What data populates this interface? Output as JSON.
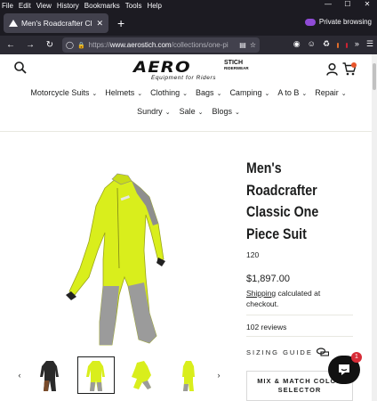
{
  "menubar": {
    "items": [
      "File",
      "Edit",
      "View",
      "History",
      "Bookmarks",
      "Tools",
      "Help"
    ]
  },
  "window_controls": {
    "minimize": "—",
    "maximize": "☐",
    "close": "✕"
  },
  "tab": {
    "title": "Men's Roadcrafter Classic One",
    "close": "✕"
  },
  "newtab": "+",
  "private_label": "Private browsing",
  "address": {
    "url_prefix": "https://",
    "url_main": "www.aerostich.com",
    "url_rest": "/collections/one-pi"
  },
  "toolbar_badges": {
    "ext1": "",
    "ext2": ""
  },
  "logo": {
    "main": "AERO",
    "stich": "STICH",
    "sub": "RIDERWEAR",
    "tagline": "Equipment for Riders"
  },
  "nav": {
    "row1": [
      "Motorcycle Suits",
      "Helmets",
      "Clothing",
      "Bags",
      "Camping",
      "A to B",
      "Repair"
    ],
    "row2": [
      "Sundry",
      "Sale",
      "Blogs"
    ]
  },
  "product": {
    "title": "Men's Roadcrafter Classic One Piece Suit",
    "sku": "120",
    "price": "$1,897.00",
    "shipping_link": "Shipping",
    "shipping_text": " calculated at checkout.",
    "reviews": "102 reviews",
    "sizing_guide": "SIZING GUIDE",
    "mix_match": "MIX & MATCH COLOR SELECTOR"
  },
  "thumbs": {
    "prev": "‹",
    "next": "›"
  },
  "chat": {
    "badge": "1"
  },
  "colors": {
    "hiviz": "#d9ee1c",
    "grey": "#8e8e8e",
    "browser_dark": "#1c1b22",
    "accent": "#e8552b"
  }
}
